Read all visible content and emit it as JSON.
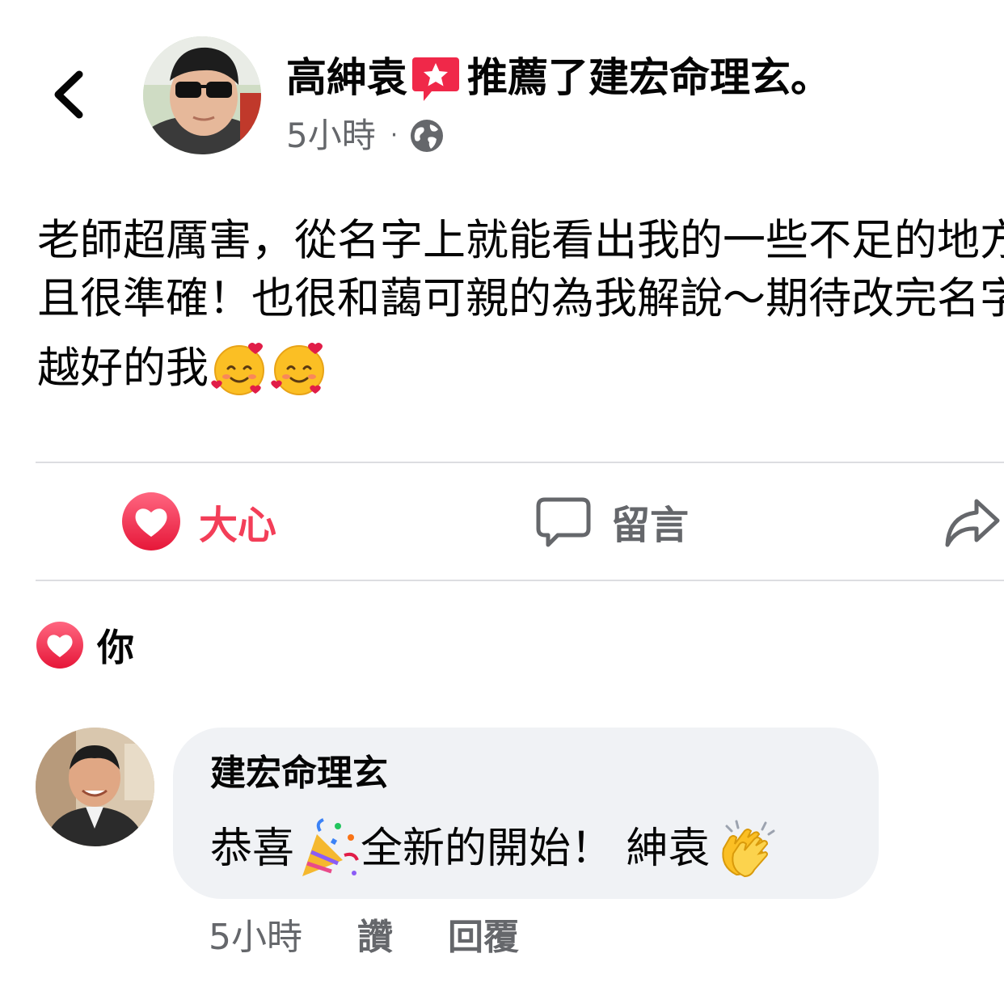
{
  "post": {
    "author": "高紳袁",
    "action": "推薦了建宏命理玄。",
    "time": "5小時",
    "separator": "·",
    "privacy_icon": "globe-icon",
    "body_line1": "老師超厲害，從名字上就能看出我的一些不足的地方",
    "body_line2": "且很準確！也很和藹可親的為我解說～期待改完名字",
    "body_line3": "越好的我",
    "body_emojis": [
      "smiling-face-with-hearts",
      "smiling-face-with-hearts"
    ]
  },
  "actions": {
    "love_label": "大心",
    "comment_label": "留言",
    "share_icon": "share-arrow-icon"
  },
  "reactions": {
    "label": "你",
    "icon": "heart-reaction-icon"
  },
  "comment": {
    "author": "建宏命理玄",
    "text_part1": "恭喜",
    "text_part2": "全新的開始！ 紳袁",
    "emojis": [
      "party-popper",
      "clapping-hands"
    ],
    "time": "5小時",
    "like_label": "讚",
    "reply_label": "回覆"
  },
  "colors": {
    "love": "#f33e58",
    "secondary_text": "#65676b",
    "bubble": "#f0f2f5",
    "divider": "#dcdde1",
    "badge": "#f02849"
  }
}
